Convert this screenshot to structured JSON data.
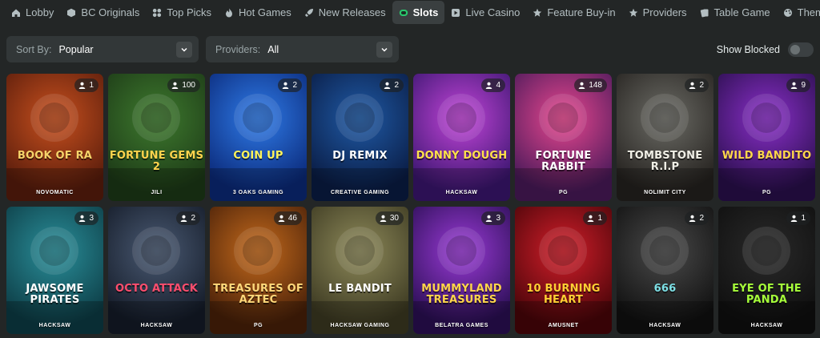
{
  "nav": [
    {
      "label": "Lobby",
      "icon": "home-icon"
    },
    {
      "label": "BC Originals",
      "icon": "dice-icon"
    },
    {
      "label": "Top Picks",
      "icon": "grid-icon"
    },
    {
      "label": "Hot Games",
      "icon": "flame-icon"
    },
    {
      "label": "New Releases",
      "icon": "rocket-icon"
    },
    {
      "label": "Slots",
      "icon": "slot-icon",
      "active": true
    },
    {
      "label": "Live Casino",
      "icon": "live-icon"
    },
    {
      "label": "Feature Buy-in",
      "icon": "star-icon"
    },
    {
      "label": "Providers",
      "icon": "star-icon"
    },
    {
      "label": "Table Game",
      "icon": "cards-icon"
    },
    {
      "label": "Themes",
      "icon": "palette-icon"
    }
  ],
  "filters": {
    "sort_label": "Sort By:",
    "sort_value": "Popular",
    "providers_label": "Providers:",
    "providers_value": "All",
    "show_blocked_label": "Show Blocked",
    "show_blocked_on": false
  },
  "games": [
    {
      "title": "BOOK OF RA",
      "provider": "NOVOMATIC",
      "players": "1",
      "bg1": "#c8501e",
      "bg2": "#5a1d0c",
      "fg": "#f6d36a"
    },
    {
      "title": "FORTUNE GEMS 2",
      "provider": "JILI",
      "players": "100",
      "bg1": "#3e7a2e",
      "bg2": "#1d3a17",
      "fg": "#ffd34d"
    },
    {
      "title": "COIN UP",
      "provider": "3 OAKS GAMING",
      "players": "2",
      "bg1": "#2f7be8",
      "bg2": "#0b2a7a",
      "fg": "#fff45a"
    },
    {
      "title": "DJ REMIX",
      "provider": "CREATIVE GAMING",
      "players": "2",
      "bg1": "#1f5aa6",
      "bg2": "#0a1c44",
      "fg": "#ffffff"
    },
    {
      "title": "DONNY DOUGH",
      "provider": "HACKSAW",
      "players": "4",
      "bg1": "#c245d8",
      "bg2": "#3b1670",
      "fg": "#ffe14a"
    },
    {
      "title": "FORTUNE RABBIT",
      "provider": "PG",
      "players": "148",
      "bg1": "#e8478f",
      "bg2": "#4a1a5a",
      "fg": "#ffffff"
    },
    {
      "title": "TOMBSTONE R.I.P",
      "provider": "NOLIMIT CITY",
      "players": "2",
      "bg1": "#6c6c66",
      "bg2": "#25221f",
      "fg": "#f0efe6"
    },
    {
      "title": "WILD BANDITO",
      "provider": "PG",
      "players": "9",
      "bg1": "#8a2fc9",
      "bg2": "#2a0f4d",
      "fg": "#ffd74a"
    },
    {
      "title": "JAWSOME PIRATES",
      "provider": "HACKSAW",
      "players": "3",
      "bg1": "#2a8f9a",
      "bg2": "#0d3d46",
      "fg": "#ffffff"
    },
    {
      "title": "OCTO ATTACK",
      "provider": "HACKSAW",
      "players": "2",
      "bg1": "#4a5a73",
      "bg2": "#141b28",
      "fg": "#ff4d6d"
    },
    {
      "title": "TREASURES OF AZTEC",
      "provider": "PG",
      "players": "46",
      "bg1": "#c46a1c",
      "bg2": "#4a2109",
      "fg": "#ffd87a"
    },
    {
      "title": "LE BANDIT",
      "provider": "HACKSAW GAMING",
      "players": "30",
      "bg1": "#8e8a5a",
      "bg2": "#3d3a22",
      "fg": "#ffffff"
    },
    {
      "title": "MUMMYLAND TREASURES",
      "provider": "BELATRA GAMES",
      "players": "3",
      "bg1": "#9a3ad6",
      "bg2": "#2b0f55",
      "fg": "#ffd54a"
    },
    {
      "title": "10 BURNING HEART",
      "provider": "AMUSNET",
      "players": "1",
      "bg1": "#d21e2a",
      "bg2": "#4a0509",
      "fg": "#ffcf33"
    },
    {
      "title": "666",
      "provider": "HACKSAW",
      "players": "2",
      "bg1": "#4a4a4a",
      "bg2": "#111111",
      "fg": "#7de0e6"
    },
    {
      "title": "EYE OF THE PANDA",
      "provider": "HACKSAW",
      "players": "1",
      "bg1": "#2a2a2a",
      "bg2": "#0f0f0f",
      "fg": "#a6ff3a"
    }
  ]
}
